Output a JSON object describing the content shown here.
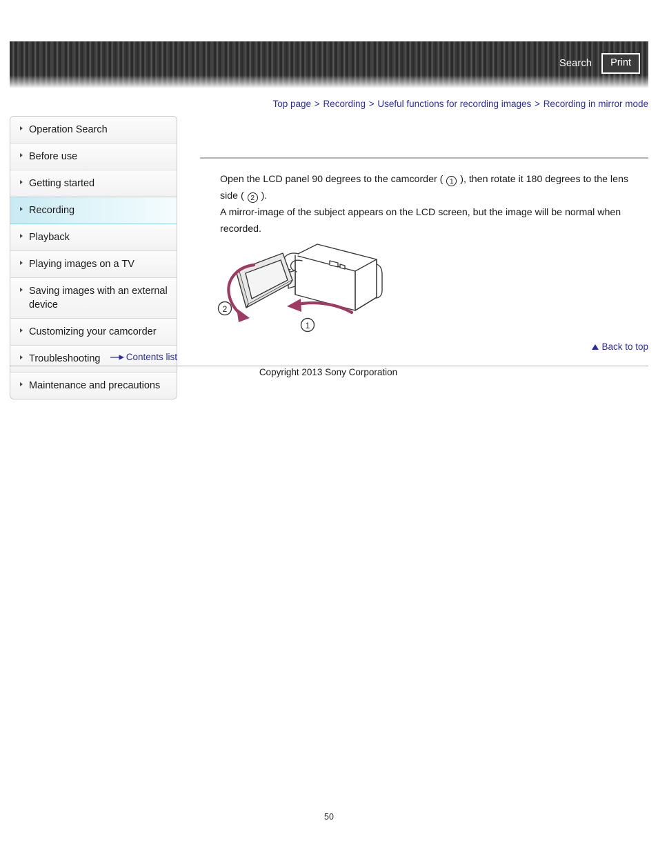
{
  "header": {
    "search_label": "Search",
    "print_label": "Print"
  },
  "breadcrumb": {
    "separator": ">",
    "items": [
      {
        "label": "Top page"
      },
      {
        "label": "Recording"
      },
      {
        "label": "Useful functions for recording images"
      },
      {
        "label": "Recording in mirror mode"
      }
    ]
  },
  "sidebar": {
    "items": [
      {
        "label": "Operation Search",
        "active": false
      },
      {
        "label": "Before use",
        "active": false
      },
      {
        "label": "Getting started",
        "active": false
      },
      {
        "label": "Recording",
        "active": true
      },
      {
        "label": "Playback",
        "active": false
      },
      {
        "label": "Playing images on a TV",
        "active": false
      },
      {
        "label": "Saving images with an external device",
        "active": false
      },
      {
        "label": "Customizing your camcorder",
        "active": false
      },
      {
        "label": "Troubleshooting",
        "active": false
      },
      {
        "label": "Maintenance and precautions",
        "active": false
      }
    ],
    "contents_list_label": "Contents list"
  },
  "main": {
    "paragraph1_part1": "Open the LCD panel 90 degrees to the camcorder ( ",
    "paragraph1_marker1": "1",
    "paragraph1_part2": " ), then rotate it 180 degrees to the lens side ( ",
    "paragraph1_marker2": "2",
    "paragraph1_part3": " ).",
    "paragraph2": "A mirror-image of the subject appears on the LCD screen, but the image will be normal when recorded.",
    "figure": {
      "alt": "Camcorder with LCD panel opened 90 degrees then rotated 180 degrees",
      "callout1": "1",
      "callout2": "2",
      "arrow_color": "#9e3a63",
      "line_color": "#3a3a3a"
    }
  },
  "footer": {
    "back_to_top_label": "Back to top",
    "copyright": "Copyright 2013 Sony Corporation",
    "page_number": "50"
  },
  "colors": {
    "link": "#2b2ba8",
    "active_nav": "#c7eaf3",
    "banner_dark": "#2b2b2b",
    "rule": "#b0b0b0"
  }
}
